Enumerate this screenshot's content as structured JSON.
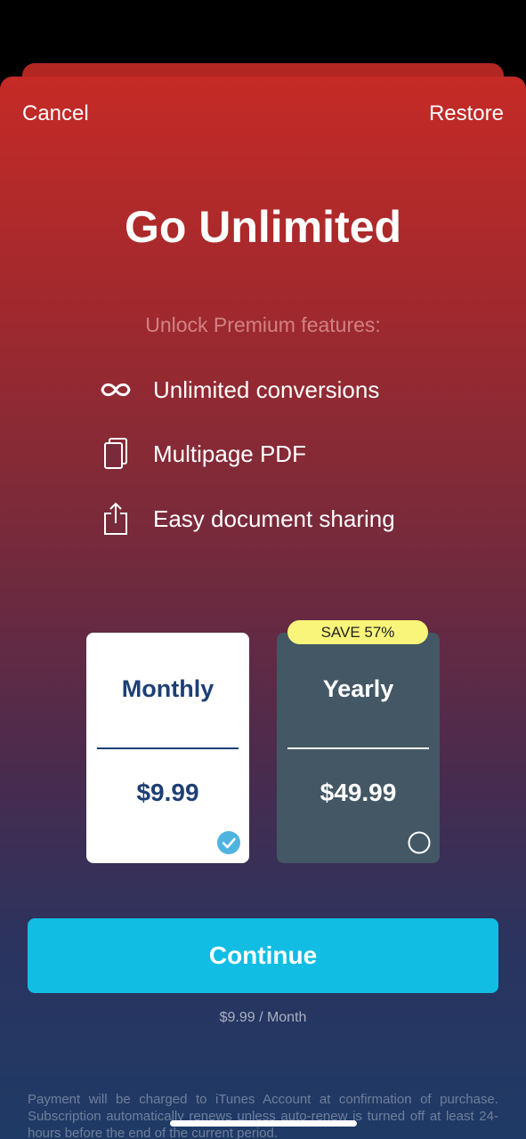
{
  "nav": {
    "cancel_label": "Cancel",
    "restore_label": "Restore"
  },
  "header": {
    "title": "Go Unlimited",
    "subtitle": "Unlock Premium features:"
  },
  "features": [
    {
      "icon": "infinity-icon",
      "label": "Unlimited conversions"
    },
    {
      "icon": "pages-icon",
      "label": "Multipage PDF"
    },
    {
      "icon": "share-icon",
      "label": "Easy document sharing"
    }
  ],
  "plans": [
    {
      "name": "Monthly",
      "price": "$9.99",
      "selected": true
    },
    {
      "name": "Yearly",
      "price": "$49.99",
      "selected": false,
      "badge": "SAVE 57%"
    }
  ],
  "cta": {
    "label": "Continue"
  },
  "price_note": "$9.99 /  Month",
  "legal_text": "Payment will be charged to iTunes Account at confirmation of purchase. Subscription automatically renews unless auto-renew is turned off at least 24-hours before the end of the current period.",
  "colors": {
    "accent": "#12bde3",
    "selected_check": "#4fb3e0",
    "badge": "#f8f57a",
    "plan_text": "#1d3f74"
  }
}
